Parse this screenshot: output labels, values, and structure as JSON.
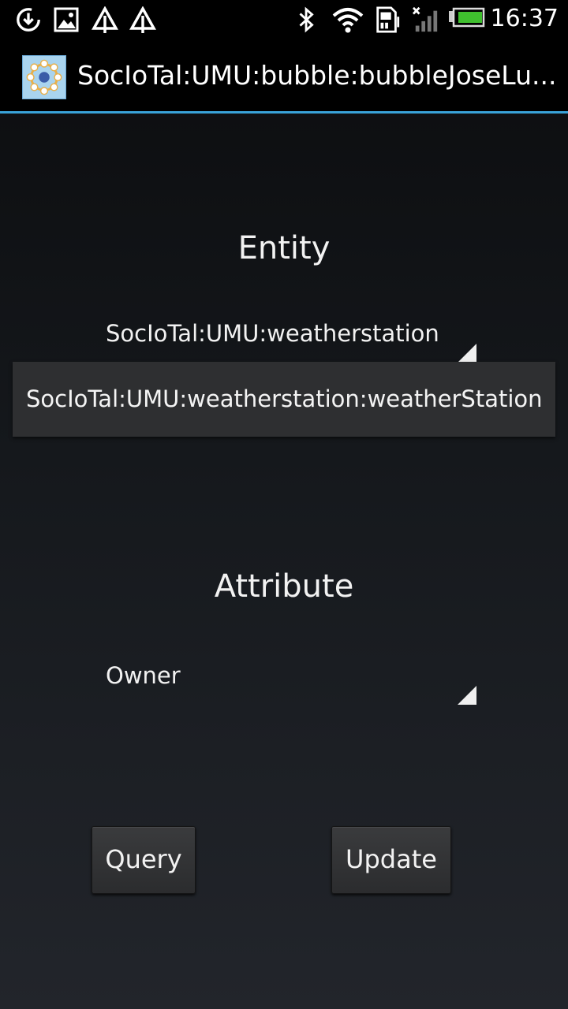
{
  "status_bar": {
    "time": "16:37",
    "left_icons": [
      "download-icon",
      "gallery-icon",
      "recycle-icon",
      "recycle-icon"
    ],
    "right_icons": [
      "bluetooth-icon",
      "wifi-icon",
      "sd-card-icon",
      "no-signal-icon",
      "battery-icon"
    ]
  },
  "action_bar": {
    "title": "SocIoTal:UMU:bubble:bubbleJoseLu...",
    "accent_color": "#39a2d8"
  },
  "entity": {
    "label": "Entity",
    "selected_value": "SocIoTal:UMU:weatherstation",
    "dropdown_item": "SocIoTal:UMU:weatherstation:weatherStation"
  },
  "attribute": {
    "label": "Attribute",
    "selected_value": "Owner"
  },
  "buttons": {
    "query_label": "Query",
    "update_label": "Update"
  }
}
